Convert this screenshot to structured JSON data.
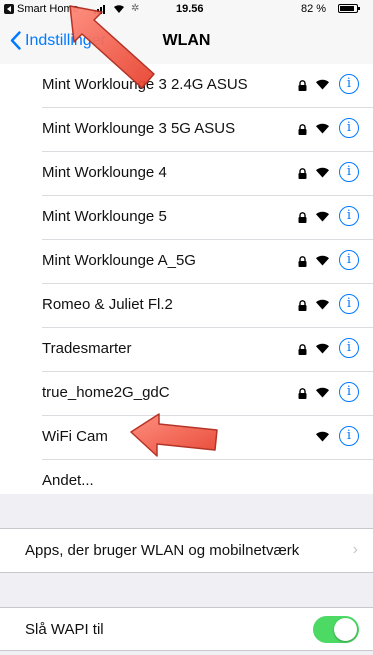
{
  "status_bar": {
    "app_name": "Smart Home",
    "time": "19.56",
    "battery": "82 %"
  },
  "nav": {
    "back_label": "Indstillinger",
    "title": "WLAN"
  },
  "networks": [
    {
      "name": "Mint Worklounge 3 2.4G ASUS",
      "locked": true
    },
    {
      "name": "Mint Worklounge 3 5G ASUS",
      "locked": true
    },
    {
      "name": "Mint Worklounge 4",
      "locked": true
    },
    {
      "name": "Mint Worklounge 5",
      "locked": true
    },
    {
      "name": "Mint Worklounge A_5G",
      "locked": true
    },
    {
      "name": "Romeo & Juliet Fl.2",
      "locked": true
    },
    {
      "name": "Tradesmarter",
      "locked": true
    },
    {
      "name": "true_home2G_gdC",
      "locked": true
    },
    {
      "name": "WiFi Cam",
      "locked": false
    }
  ],
  "other_network_label": "Andet...",
  "apps_row_label": "Apps, der bruger WLAN og mobilnetværk",
  "wapi_row_label": "Slå WAPI til",
  "wapi_enabled": true,
  "colors": {
    "accent": "#007aff",
    "toggle_on": "#4cd964",
    "annotation_arrow": "#f04a3a"
  }
}
